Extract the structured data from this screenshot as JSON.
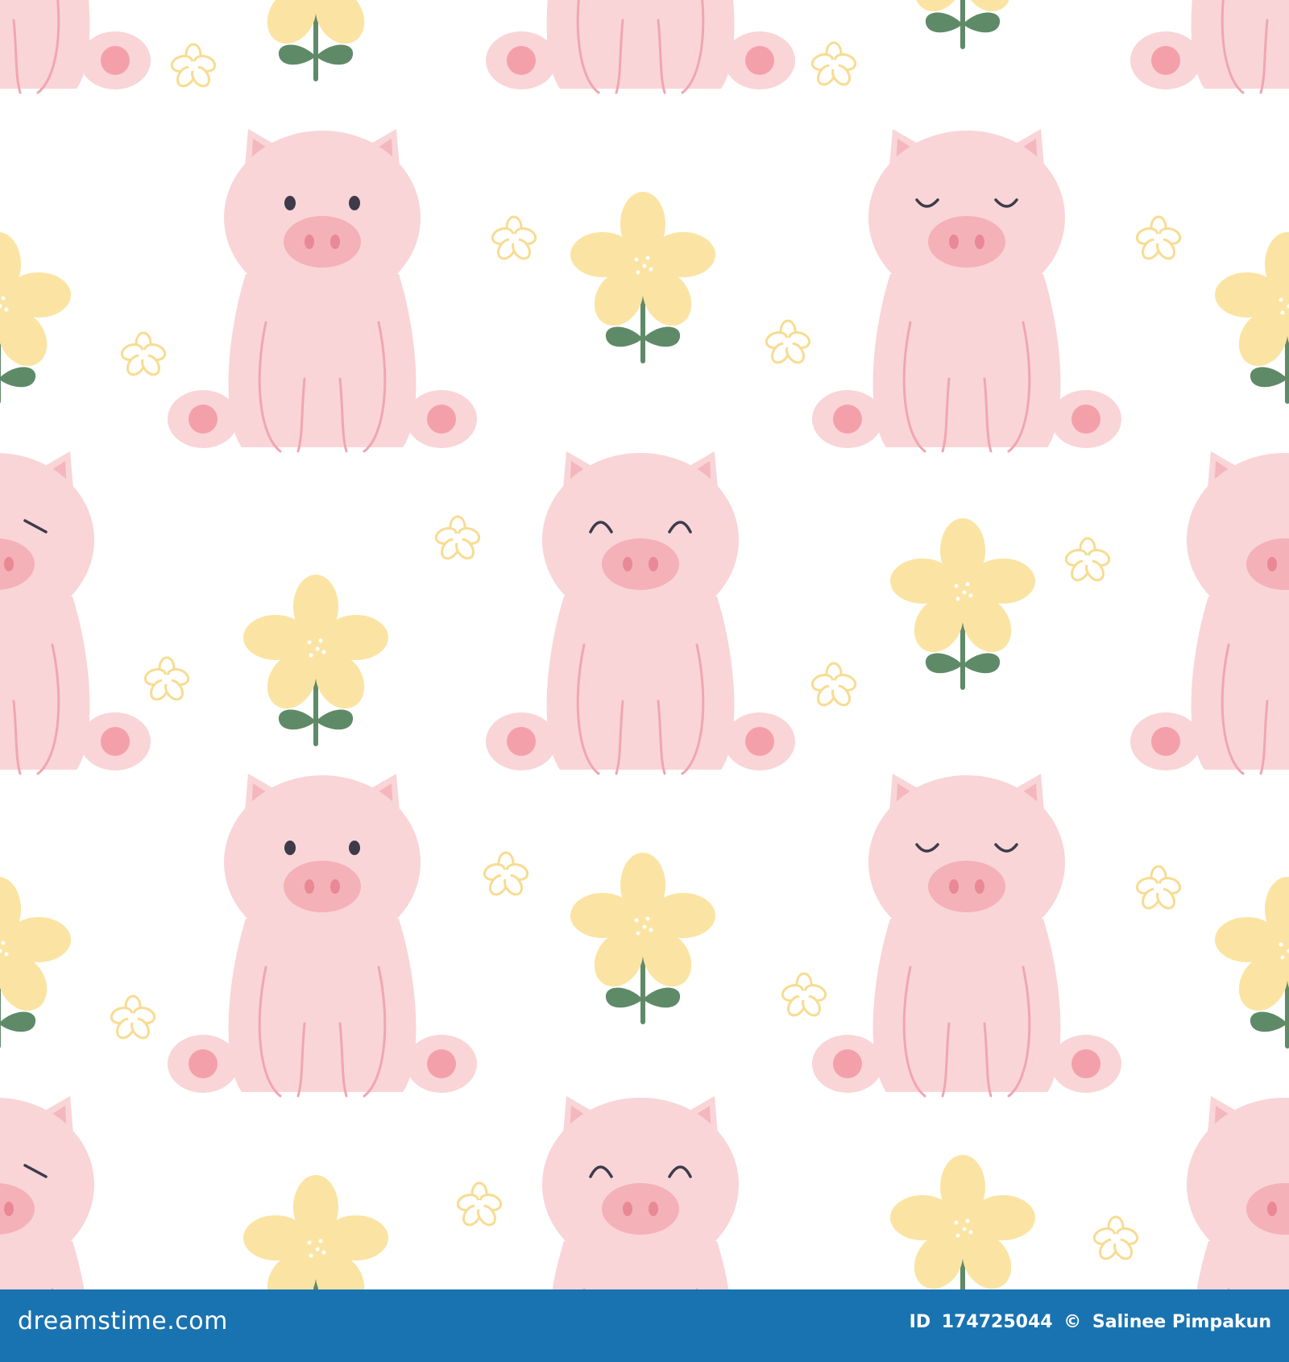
{
  "palette": {
    "background": "#ffffff",
    "pig_body": "#f9d5d7",
    "pig_ear_inner": "#f3b7bd",
    "pig_snout": "#f4b1b8",
    "pig_nostril": "#e98995",
    "pig_line": "#f0a6b0",
    "pig_foot": "#f4a0aa",
    "pig_eye": "#3d3b4a",
    "flower_petal": "#fbe4a3",
    "flower_center_dot": "#ffffff",
    "flower_stem": "#5f8a68",
    "small_flower_outline": "#f7dc92",
    "bottom_bar": "#1a73b1"
  },
  "scene": {
    "description_icons": [
      "pig-icon",
      "flower-icon",
      "small-flower-icon"
    ],
    "pig_faces": [
      "open-eyes",
      "smiling-eyes",
      "closed-eyes",
      "winking"
    ]
  },
  "footer": {
    "brand": "dreamstime.com",
    "id_label": "ID",
    "id_number": "174725044",
    "copyright_symbol": "©",
    "author": "Salinee Pimpakun"
  }
}
